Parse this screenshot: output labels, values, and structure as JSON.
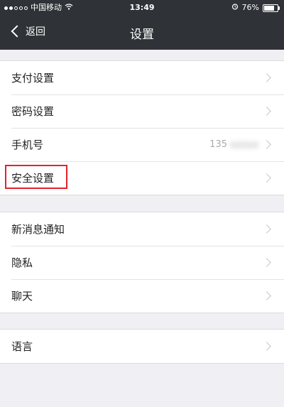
{
  "status": {
    "carrier": "中国移动",
    "time": "13:49",
    "battery": "76%",
    "battery_level": 0.76
  },
  "nav": {
    "back_label": "返回",
    "title": "设置"
  },
  "groups": [
    {
      "items": [
        {
          "label": "支付设置"
        },
        {
          "label": "密码设置"
        },
        {
          "label": "手机号",
          "value": "135"
        },
        {
          "label": "安全设置",
          "highlighted": true
        }
      ]
    },
    {
      "items": [
        {
          "label": "新消息通知"
        },
        {
          "label": "隐私"
        },
        {
          "label": "聊天"
        }
      ]
    },
    {
      "items": [
        {
          "label": "语言"
        }
      ]
    }
  ],
  "colors": {
    "highlight_border": "#e0242b",
    "navbar_bg": "#2f3236",
    "page_bg": "#efeff4"
  }
}
